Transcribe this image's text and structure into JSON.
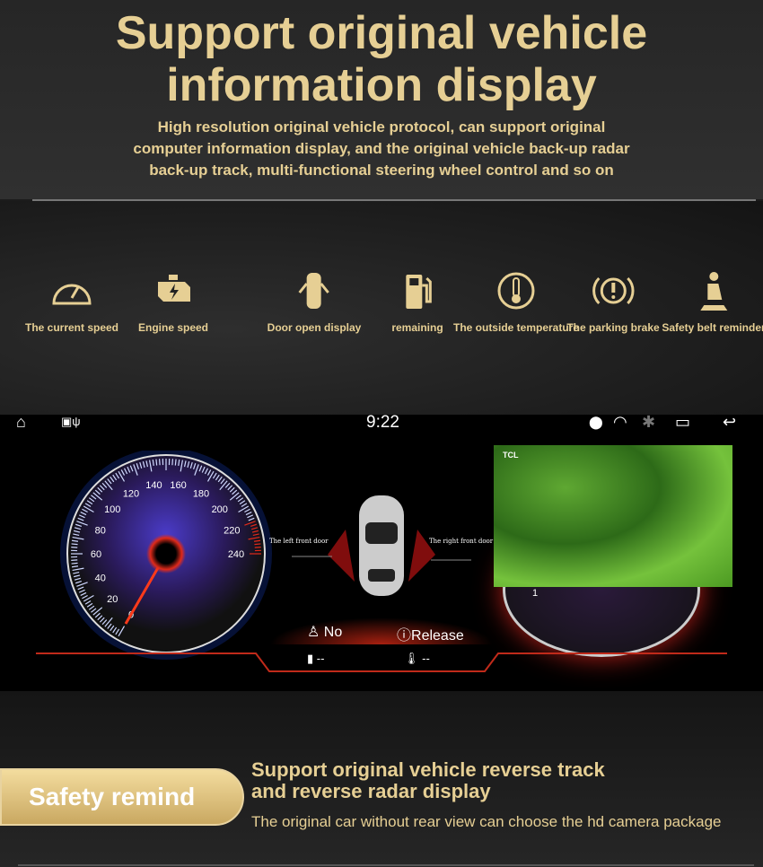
{
  "header": {
    "title_line1": "Support original vehicle",
    "title_line2": "information display",
    "subtitle": [
      "High resolution original vehicle protocol, can support original",
      "computer information display, and the original vehicle back-up radar",
      "back-up track, multi-functional steering wheel control and so on"
    ]
  },
  "features": [
    {
      "label": "The current speed",
      "icon": "speedometer-icon"
    },
    {
      "label": "Engine speed",
      "icon": "engine-icon"
    },
    {
      "label": "Door open display",
      "icon": "car-door-icon"
    },
    {
      "label": "remaining",
      "icon": "fuel-pump-icon"
    },
    {
      "label": "The outside temperature",
      "icon": "thermometer-icon"
    },
    {
      "label": "The parking brake",
      "icon": "parking-brake-icon"
    },
    {
      "label": "Safety belt reminder",
      "icon": "seatbelt-icon"
    }
  ],
  "screen": {
    "time": "9:22",
    "speedometer": {
      "ticks": [
        0,
        20,
        40,
        60,
        80,
        100,
        120,
        140,
        160,
        180,
        200,
        220,
        240
      ],
      "value": 0
    },
    "tachometer_visible_label": "1",
    "doors": {
      "left": "The left front door",
      "right": "The right front door"
    },
    "seatbelt": "No",
    "parking_brake": "Release",
    "fuel": "--",
    "temperature": "--",
    "pip_label": "TCL"
  },
  "footer": {
    "button": "Safety remind",
    "heading_line1": "Support original vehicle reverse track",
    "heading_line2": "and reverse radar display",
    "text": "The original car without rear view can choose the hd camera package"
  },
  "colors": {
    "gold": "#e6cf94",
    "accent_red": "#e02a1a",
    "gauge_blue": "#3a7bff"
  }
}
